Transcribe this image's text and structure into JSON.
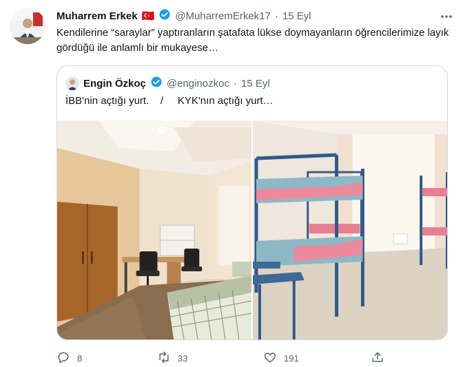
{
  "tweet": {
    "author_name": "Muharrem Erkek",
    "flag": "🇹🇷",
    "handle": "@MuharremErkek17",
    "separator": "·",
    "date": "15 Eyl",
    "text": "Kendilerine “saraylar” yaptıranların şatafata lükse doymayanların öğrencilerimize layık gördüğü ile anlamlı bir mukayese…",
    "more_icon": "more-icon"
  },
  "quote": {
    "author_name": "Engin Özkoç",
    "handle": "@enginozkoc",
    "separator": "·",
    "date": "15 Eyl",
    "text": "İBB'nin açtığı yurt.    /     KYK'nın açtığı yurt…"
  },
  "actions": {
    "reply_count": "8",
    "retweet_count": "33",
    "like_count": "191"
  },
  "colors": {
    "verified": "#1d9bf0",
    "text_secondary": "#536471",
    "border": "#cfd9de"
  }
}
